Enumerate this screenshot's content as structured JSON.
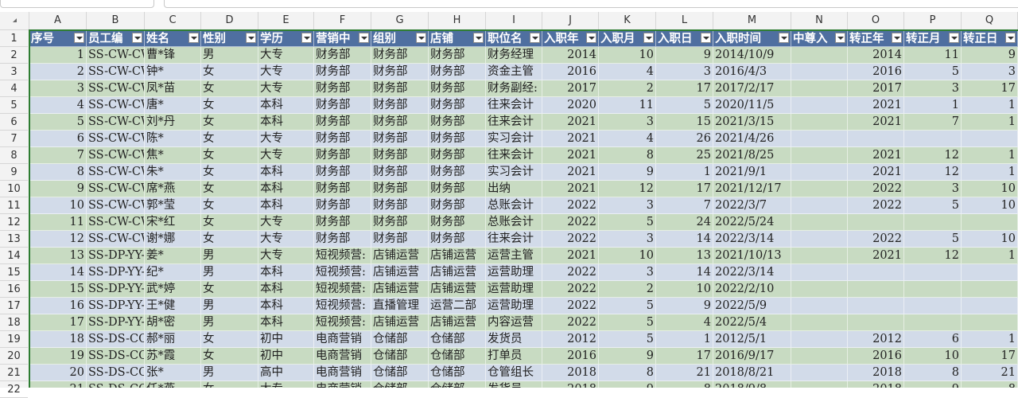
{
  "colors": {
    "header_bg": "#4f6fa0",
    "band_odd": "#c8dbc2",
    "band_even": "#d2dbe9",
    "select_border": "#2e7d32"
  },
  "column_letters": [
    "A",
    "B",
    "C",
    "D",
    "E",
    "F",
    "G",
    "H",
    "I",
    "J",
    "K",
    "L",
    "M",
    "N",
    "O",
    "P",
    "Q"
  ],
  "row_numbers": [
    "1",
    "2",
    "3",
    "4",
    "5",
    "6",
    "7",
    "8",
    "9",
    "10",
    "11",
    "12",
    "13",
    "14",
    "15",
    "16",
    "17",
    "18",
    "19",
    "20",
    "21",
    "22"
  ],
  "headers": [
    "序号",
    "员工编",
    "姓名",
    "性别",
    "学历",
    "营销中",
    "组别",
    "店铺",
    "职位名",
    "入职年",
    "入职月",
    "入职日",
    "入职时间",
    "中尊入",
    "转正年",
    "转正月",
    "转正日"
  ],
  "rows": [
    [
      "1",
      "SS-CW-CW-",
      "曹*锋",
      "男",
      "大专",
      "财务部",
      "财务部",
      "财务部",
      "财务经理",
      "2014",
      "10",
      "9",
      "2014/10/9",
      "",
      "2014",
      "11",
      "9"
    ],
    [
      "2",
      "SS-CW-CW-",
      "钟*",
      "女",
      "大专",
      "财务部",
      "财务部",
      "财务部",
      "资金主管",
      "2016",
      "4",
      "3",
      "2016/4/3",
      "",
      "2016",
      "5",
      "3"
    ],
    [
      "3",
      "SS-CW-CW-",
      "凤*苗",
      "女",
      "大专",
      "财务部",
      "财务部",
      "财务部",
      "财务副经:",
      "2017",
      "2",
      "17",
      "2017/2/17",
      "",
      "2017",
      "3",
      "17"
    ],
    [
      "4",
      "SS-CW-CW-",
      "唐*",
      "女",
      "本科",
      "财务部",
      "财务部",
      "财务部",
      "往来会计",
      "2020",
      "11",
      "5",
      "2020/11/5",
      "",
      "2021",
      "1",
      "1"
    ],
    [
      "5",
      "SS-CW-CW-",
      "刘*丹",
      "女",
      "本科",
      "财务部",
      "财务部",
      "财务部",
      "往来会计",
      "2021",
      "3",
      "15",
      "2021/3/15",
      "",
      "2021",
      "7",
      "1"
    ],
    [
      "6",
      "SS-CW-CW-",
      "陈*",
      "女",
      "大专",
      "财务部",
      "财务部",
      "财务部",
      "实习会计",
      "2021",
      "4",
      "26",
      "2021/4/26",
      "",
      "",
      "",
      ""
    ],
    [
      "7",
      "SS-CW-CW-",
      "焦*",
      "女",
      "大专",
      "财务部",
      "财务部",
      "财务部",
      "往来会计",
      "2021",
      "8",
      "25",
      "2021/8/25",
      "",
      "2021",
      "12",
      "1"
    ],
    [
      "8",
      "SS-CW-CW-",
      "朱*",
      "女",
      "本科",
      "财务部",
      "财务部",
      "财务部",
      "实习会计",
      "2021",
      "9",
      "1",
      "2021/9/1",
      "",
      "2021",
      "12",
      "1"
    ],
    [
      "9",
      "SS-CW-CW-",
      "席*燕",
      "女",
      "本科",
      "财务部",
      "财务部",
      "财务部",
      "出纳",
      "2021",
      "12",
      "17",
      "2021/12/17",
      "",
      "2022",
      "3",
      "10"
    ],
    [
      "10",
      "SS-CW-CW-",
      "郭*莹",
      "女",
      "本科",
      "财务部",
      "财务部",
      "财务部",
      "总账会计",
      "2022",
      "3",
      "7",
      "2022/3/7",
      "",
      "2022",
      "5",
      "10"
    ],
    [
      "11",
      "SS-CW-CW-",
      "宋*红",
      "女",
      "大专",
      "财务部",
      "财务部",
      "财务部",
      "总账会计",
      "2022",
      "5",
      "24",
      "2022/5/24",
      "",
      "",
      "",
      ""
    ],
    [
      "12",
      "SS-CW-CW-",
      "谢*娜",
      "女",
      "大专",
      "财务部",
      "财务部",
      "财务部",
      "往来会计",
      "2022",
      "3",
      "14",
      "2022/3/14",
      "",
      "2022",
      "5",
      "10"
    ],
    [
      "13",
      "SS-DP-YY-",
      "姜*",
      "男",
      "大专",
      "短视频营:",
      "店铺运营",
      "店铺运营",
      "运营主管",
      "2021",
      "10",
      "13",
      "2021/10/13",
      "",
      "2021",
      "12",
      "1"
    ],
    [
      "14",
      "SS-DP-YY-",
      "纪*",
      "男",
      "本科",
      "短视频营:",
      "店铺运营",
      "店铺运营",
      "运营助理",
      "2022",
      "3",
      "14",
      "2022/3/14",
      "",
      "",
      "",
      ""
    ],
    [
      "15",
      "SS-DP-YY-",
      "武*婷",
      "女",
      "本科",
      "短视频营:",
      "店铺运营",
      "店铺运营",
      "运营助理",
      "2022",
      "2",
      "10",
      "2022/2/10",
      "",
      "",
      "",
      ""
    ],
    [
      "16",
      "SS-DP-YY-",
      "王*健",
      "男",
      "本科",
      "短视频营:",
      "直播管理",
      "运营二部",
      "运营助理",
      "2022",
      "5",
      "9",
      "2022/5/9",
      "",
      "",
      "",
      ""
    ],
    [
      "17",
      "SS-DP-YY-",
      "胡*密",
      "男",
      "本科",
      "短视频营:",
      "店铺运营",
      "店铺运营",
      "内容运营",
      "2022",
      "5",
      "4",
      "2022/5/4",
      "",
      "",
      "",
      ""
    ],
    [
      "18",
      "SS-DS-CC-",
      "郝*丽",
      "女",
      "初中",
      "电商营销",
      "仓储部",
      "仓储部",
      "发货员",
      "2012",
      "5",
      "1",
      "2012/5/1",
      "",
      "2012",
      "6",
      "1"
    ],
    [
      "19",
      "SS-DS-CC-",
      "苏*霞",
      "女",
      "初中",
      "电商营销",
      "仓储部",
      "仓储部",
      "打单员",
      "2016",
      "9",
      "17",
      "2016/9/17",
      "",
      "2016",
      "10",
      "17"
    ],
    [
      "20",
      "SS-DS-CC-",
      "张*",
      "男",
      "高中",
      "电商营销",
      "仓储部",
      "仓储部",
      "仓管组长",
      "2018",
      "8",
      "21",
      "2018/8/21",
      "",
      "2018",
      "8",
      "21"
    ],
    [
      "21",
      "SS-DS-CC-",
      "任*燕",
      "女",
      "大专",
      "电商营销",
      "仓储部",
      "仓储部",
      "发货员",
      "2018",
      "9",
      "8",
      "2018/9/8",
      "",
      "2018",
      "9",
      "8"
    ]
  ]
}
